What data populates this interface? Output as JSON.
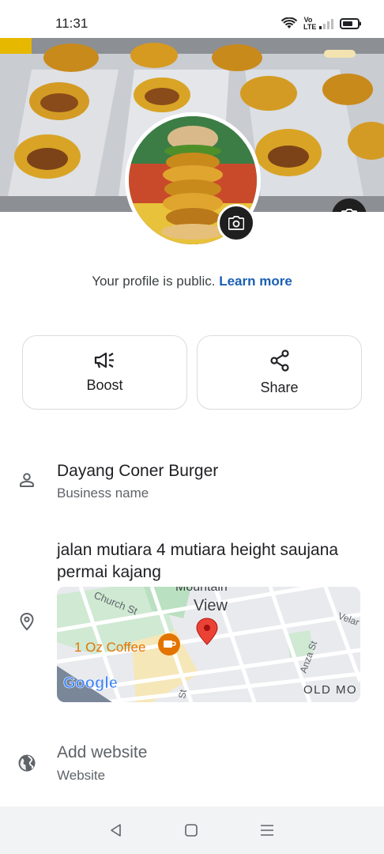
{
  "status_bar": {
    "time": "11:31",
    "volte_label": "Vo LTE"
  },
  "profile": {
    "public_text": "Your profile is public.",
    "learn_more": "Learn more"
  },
  "actions": [
    {
      "label": "Boost",
      "icon": "megaphone-icon"
    },
    {
      "label": "Share",
      "icon": "share-icon"
    }
  ],
  "business": {
    "name": "Dayang Coner Burger",
    "name_caption": "Business name",
    "address": "jalan mutiara 4 mutiara height saujana permai kajang",
    "website_label": "Add website",
    "website_caption": "Website"
  },
  "map": {
    "labels": {
      "area_top": "Mountain",
      "area_view": "View",
      "church_st": "Church St",
      "coffee": "1 Oz Coffee",
      "anza_st": "Anza St",
      "old_mo": "OLD MO",
      "velar": "Velar",
      "st": "St",
      "google": "Google"
    },
    "colors": {
      "pin": "#ea4335",
      "coffee": "#e37400",
      "park": "#bfe3c5"
    }
  },
  "colors": {
    "link": "#1a5fb4",
    "camera_button": "#1f1f1f",
    "card_border": "#dadce0",
    "nav_bar": "#f1f3f4"
  }
}
